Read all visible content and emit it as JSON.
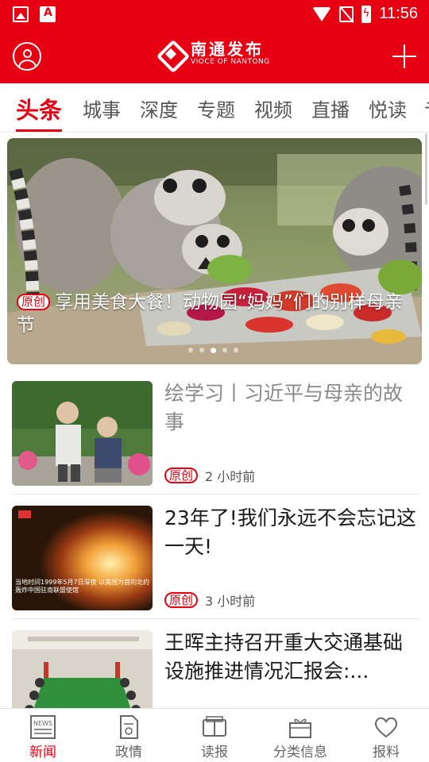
{
  "status_bar": {
    "time": "11:56",
    "left_icons": [
      "image-icon",
      "a-app-icon"
    ],
    "a_icon_letter": "A",
    "right_icons": [
      "wifi-icon",
      "no-sim-icon",
      "battery-charging-icon"
    ]
  },
  "header": {
    "logo_cn": "南通发布",
    "logo_en": "VIOCE OF NANTONG",
    "left_icon": "user-icon",
    "right_icon": "plus-icon",
    "background_color": "#e60012"
  },
  "tabs": {
    "items": [
      {
        "label": "头条",
        "active": true
      },
      {
        "label": "城事",
        "active": false
      },
      {
        "label": "深度",
        "active": false
      },
      {
        "label": "专题",
        "active": false
      },
      {
        "label": "视频",
        "active": false
      },
      {
        "label": "直播",
        "active": false
      },
      {
        "label": "悦读",
        "active": false
      },
      {
        "label": "亍",
        "active": false
      }
    ],
    "active_color": "#e60012"
  },
  "hero": {
    "tag": "原创",
    "title": "享用美食大餐！动物园“妈妈”们的别样母亲节",
    "slide_count": 5,
    "active_slide": 3
  },
  "articles": [
    {
      "title": "绘学习丨习近平与母亲的故事",
      "tag": "原创",
      "time": "2 小时前",
      "read": true
    },
    {
      "title": "23年了!我们永远不会忘记这一天!",
      "tag": "原创",
      "time": "3 小时前",
      "read": false,
      "thumb_caption": "当地时间1999年5月7日深夜 以美国为首的北约 轰炸中国驻南联盟使馆"
    },
    {
      "title": "王晖主持召开重大交通基础设施推进情况汇报会:...",
      "tag": "",
      "time": "",
      "read": false
    }
  ],
  "bottom_nav": {
    "items": [
      {
        "label": "新闻",
        "icon": "news-icon",
        "active": true
      },
      {
        "label": "政情",
        "icon": "document-icon",
        "active": false
      },
      {
        "label": "读报",
        "icon": "newspaper-icon",
        "active": false
      },
      {
        "label": "分类信息",
        "icon": "gift-icon",
        "active": false
      },
      {
        "label": "报料",
        "icon": "heart-icon",
        "active": false
      }
    ],
    "news_icon_text": "NEWS"
  }
}
